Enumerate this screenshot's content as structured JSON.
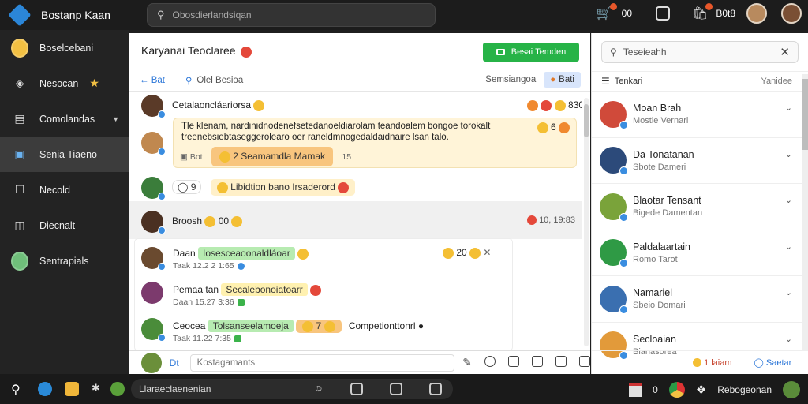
{
  "app": {
    "title": "Bostanp Kaan"
  },
  "topbar": {
    "search_placeholder": "Obosdierlandsiqan",
    "notif_count_1": "00",
    "notif_label_2": "B0t8"
  },
  "sidebar": {
    "items": [
      {
        "label": "Boselcebani"
      },
      {
        "label": "Nesocan"
      },
      {
        "label": "Comolandas"
      },
      {
        "label": "Senia Tiaeno"
      },
      {
        "label": "Necold"
      },
      {
        "label": "Diecnalt"
      },
      {
        "label": "Sentrapials"
      }
    ]
  },
  "chat": {
    "title": "Karyanai  Teoclaree",
    "primary_button": "Besai Temden",
    "back_label": "Bat",
    "search_label": "Olel Besioa",
    "sort_label": "Semsiangoa",
    "tag_label": "Bati",
    "messages": [
      {
        "name": "Cetalaoncláariorsa",
        "stat": "830"
      },
      {
        "text_line1": "Tle klenam, nardinidnodenefsetedanoeldiarolam teandoalem bongoe torokalt",
        "text_line2": "treenebsiebtaseggerolearo  oer raneldmnogedaldaidnaire lsan talo.",
        "reaction": "6",
        "sub_label": "Bot",
        "pill": "2 Seamamdla Mamak",
        "pill_count": "15"
      },
      {
        "chip": "9",
        "pill": "Libidtion bano Irsaderord"
      },
      {
        "name": "Broosh",
        "count": "00",
        "time": "10, 19:83"
      }
    ],
    "thread": [
      {
        "name": "Daan",
        "tag": "Iosesceaoonaldláoar",
        "meta": "Taak  12.2 2 1:65",
        "react": "20"
      },
      {
        "name": "Pemaa tan",
        "tag": "Secalebonoiatoarr",
        "meta": "Daan  15.27 3:36"
      },
      {
        "name": "Ceocea",
        "tag": "Tolsanseelamoeja",
        "reaction": "7",
        "trail": "Competionttonrl",
        "meta": "Taak  11.22 7:35"
      }
    ],
    "composer": {
      "prefix": "Dt",
      "placeholder": "Kostagamants"
    }
  },
  "rpanel": {
    "search_placeholder": "Teseieahh",
    "header_left": "Tenkari",
    "header_right": "Yanidee",
    "people": [
      {
        "name": "Moan Brah",
        "sub": "Mostie Vernarl"
      },
      {
        "name": "Da Tonatanan",
        "sub": "Sbote Dameri"
      },
      {
        "name": "Blaotar Tensant",
        "sub": "Bigede Damentan"
      },
      {
        "name": "Paldalaartain",
        "sub": "Romo Tarot"
      },
      {
        "name": "Namariel",
        "sub": "Sbeio Domari"
      },
      {
        "name": "Secloaian",
        "sub": "Bianasorea"
      }
    ],
    "footer_a": "1 laiam",
    "footer_b": "Saetar"
  },
  "taskbar": {
    "search_text": "Llaraeclaenenian",
    "count": "0",
    "user": "Rebogeonan"
  },
  "colors": {
    "accent_green": "#27b347",
    "accent_blue": "#2b76d8",
    "sidebar_bg": "#232323"
  }
}
